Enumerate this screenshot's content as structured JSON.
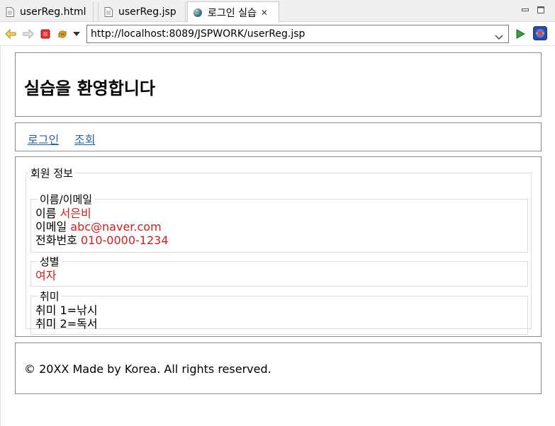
{
  "tabs": [
    {
      "label": "userReg.html",
      "icon": "file-icon"
    },
    {
      "label": "userReg.jsp",
      "icon": "file-icon"
    },
    {
      "label": "로그인 실습",
      "icon": "globe-icon",
      "active": true
    }
  ],
  "toolbar": {
    "url": "http://localhost:8089/JSPWORK/userReg.jsp"
  },
  "page": {
    "title": "실습을 환영합니다",
    "nav": [
      "로그인",
      "조회"
    ],
    "member_legend": "회원 정보",
    "name_email_legend": "이름/이메일",
    "name_label": "이름",
    "name_value": "서은비",
    "email_label": "이메일",
    "email_value": "abc@naver.com",
    "phone_label": "전화번호",
    "phone_value": "010-0000-1234",
    "gender_legend": "성별",
    "gender_value": "여자",
    "hobby_legend": "취미",
    "hobby1": "취미 1=낚시",
    "hobby2": "취미 2=독서",
    "footer": "© 20XX Made by Korea. All rights reserved."
  },
  "colors": {
    "value_red": "#d02020",
    "link_blue": "#2a64a8"
  }
}
